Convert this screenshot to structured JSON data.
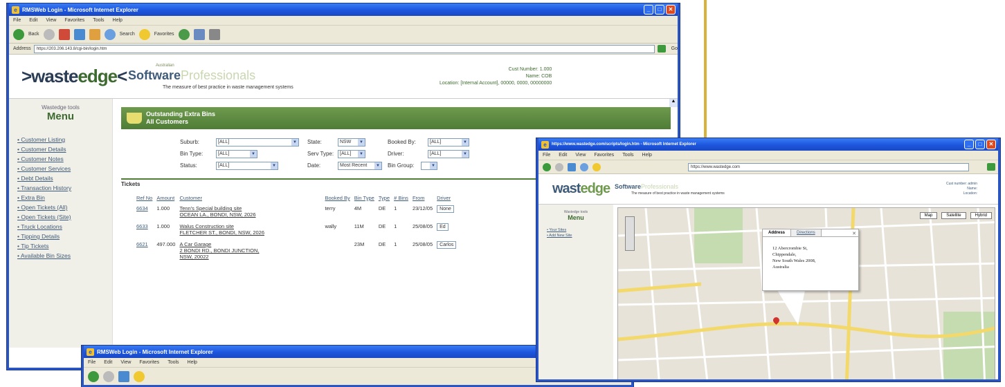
{
  "win1": {
    "title": "RMSWeb Login - Microsoft Internet Explorer",
    "menu": [
      "File",
      "Edit",
      "View",
      "Favorites",
      "Tools",
      "Help"
    ],
    "toolbar": {
      "back": "Back",
      "search": "Search",
      "favorites": "Favorites"
    },
    "address": {
      "label": "Address",
      "url": "https://203.206.143.8/cgi-bin/login.htm",
      "go": "Go"
    },
    "logo": {
      "pre": ">waste",
      "mid": "edge",
      "post": "<"
    },
    "swp": {
      "super": "Australian",
      "main": "Software",
      "pro": "Professionals",
      "tag": "The measure of best practice in waste management systems"
    },
    "cust": {
      "line1": "Cust Number: 1.000",
      "line2": "Name: COB",
      "line3": "Location: [Internal Account], 00000, 0000, 00000000"
    },
    "sidebar": {
      "sub": "Wastedge tools",
      "title": "Menu",
      "items": [
        "Customer Listing",
        "Customer Details",
        "Customer Notes",
        "Customer Services",
        "Debt Details",
        "Transaction History",
        "Extra Bin",
        "Open Tickets (All)",
        "Open Tickets (Site)",
        "Truck Locations",
        "Tipping Details",
        "Tip Tickets",
        "Available Bin Sizes"
      ]
    },
    "banner": {
      "line1": "Outstanding Extra Bins",
      "line2": "All Customers"
    },
    "filters": {
      "suburb_l": "Suburb:",
      "suburb_v": "[ALL]",
      "state_l": "State:",
      "state_v": "NSW",
      "booked_l": "Booked By:",
      "booked_v": "[ALL]",
      "bintype_l": "Bin Type:",
      "bintype_v": "[ALL]",
      "servtype_l": "Serv Type:",
      "servtype_v": "[ALL]",
      "driver_l": "Driver:",
      "driver_v": "[ALL]",
      "status_l": "Status:",
      "status_v": "[ALL]",
      "date_l": "Date:",
      "date_v": "Most Recent",
      "bingroup_l": "Bin Group:",
      "bingroup_v": ""
    },
    "tickets_label": "Tickets",
    "table": {
      "headers": [
        "Ref No",
        "Amount",
        "Customer",
        "Booked By",
        "Bin Type",
        "Type",
        "# Bins",
        "From",
        "Driver"
      ],
      "rows": [
        {
          "ref": "6634",
          "amount": "1.000",
          "cust1": "Tenn's Special building site",
          "cust2": "OCEAN LA., BONDI, NSW, 2026",
          "booked": "terry",
          "bin": "4M",
          "type": "DE",
          "bins": "1",
          "date": "23/12/05",
          "driver": "None"
        },
        {
          "ref": "6633",
          "amount": "1.000",
          "cust1": "Walus Construction site",
          "cust2": "FLETCHER ST., BONDI, NSW, 2026",
          "booked": "wally",
          "bin": "11M",
          "type": "DE",
          "bins": "1",
          "date": "25/08/05",
          "driver": "Ed"
        },
        {
          "ref": "6621",
          "amount": "497.000",
          "cust1": "A Car Garage",
          "cust2": "2 BONDI RD., BONDI JUNCTION,",
          "cust3": "NSW, 20022",
          "booked": "",
          "bin": "23M",
          "type": "DE",
          "bins": "1",
          "date": "25/08/05",
          "driver": "Carlos"
        }
      ]
    }
  },
  "win2": {
    "title": "https://www.wastedge.com/scripts/login.htm - Microsoft Internet Explorer",
    "address_url": "https://www.wastedge.com",
    "logo": {
      "a": "wast",
      "b": "edge"
    },
    "swp": {
      "main": "Software",
      "pro": "Professionals",
      "tag": "The measure of best practice in waste management systems"
    },
    "cust": {
      "line1": "Cust number: admin",
      "line2": "Name:",
      "line3": "Location:"
    },
    "side": {
      "sub": "Wastedge tools",
      "title": "Menu",
      "items": [
        "Your Sites",
        "Add New Site"
      ]
    },
    "map_btns": [
      "Map",
      "Satellite",
      "Hybrid"
    ],
    "info": {
      "tab1": "Address",
      "tab2": "Directions",
      "line1": "12 Abercrombie St,",
      "line2": "Chippendale,",
      "line3": "New South Wales 2008,",
      "line4": "Australia"
    }
  },
  "win3": {
    "title": "RMSWeb Login - Microsoft Internet Explorer"
  },
  "colors": {
    "accent_green": "#4f7d36",
    "xp_blue": "#1c56de",
    "divider_yellow": "#d8b23a"
  }
}
